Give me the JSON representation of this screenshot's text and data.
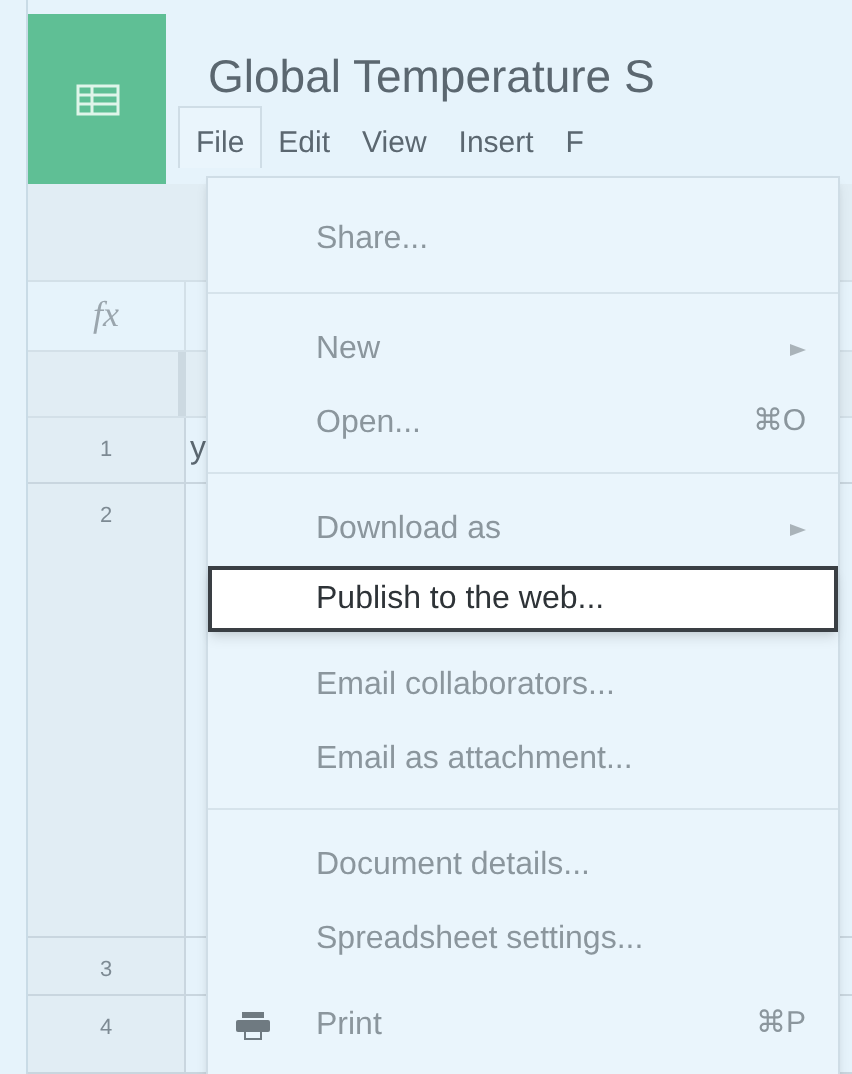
{
  "document": {
    "title": "Global Temperature S"
  },
  "menubar": [
    {
      "label": "File",
      "selected": true
    },
    {
      "label": "Edit",
      "selected": false
    },
    {
      "label": "View",
      "selected": false
    },
    {
      "label": "Insert",
      "selected": false
    },
    {
      "label": "F",
      "selected": false
    }
  ],
  "sheet": {
    "formula_label": "fx",
    "rows": [
      {
        "number": "1",
        "cell": "y"
      },
      {
        "number": "2"
      },
      {
        "number": "3"
      },
      {
        "number": "4"
      }
    ]
  },
  "file_menu": [
    [
      {
        "label": "Share...",
        "kind": "plain",
        "selected": false
      }
    ],
    [
      {
        "label": "New",
        "kind": "submenu",
        "selected": false
      },
      {
        "label": "Open...",
        "kind": "plain",
        "shortcut": "⌘O",
        "selected": false
      }
    ],
    [
      {
        "label": "Download as",
        "kind": "submenu",
        "selected": false
      },
      {
        "label": "Publish to the web...",
        "kind": "plain",
        "selected": true
      },
      {
        "label": "Email collaborators...",
        "kind": "plain",
        "selected": false
      },
      {
        "label": "Email as attachment...",
        "kind": "plain",
        "selected": false
      }
    ],
    [
      {
        "label": "Document details...",
        "kind": "plain",
        "selected": false
      },
      {
        "label": "Spreadsheet settings...",
        "kind": "plain",
        "selected": false
      },
      {
        "label": "Print",
        "kind": "print",
        "shortcut": "⌘P",
        "selected": false
      }
    ]
  ]
}
